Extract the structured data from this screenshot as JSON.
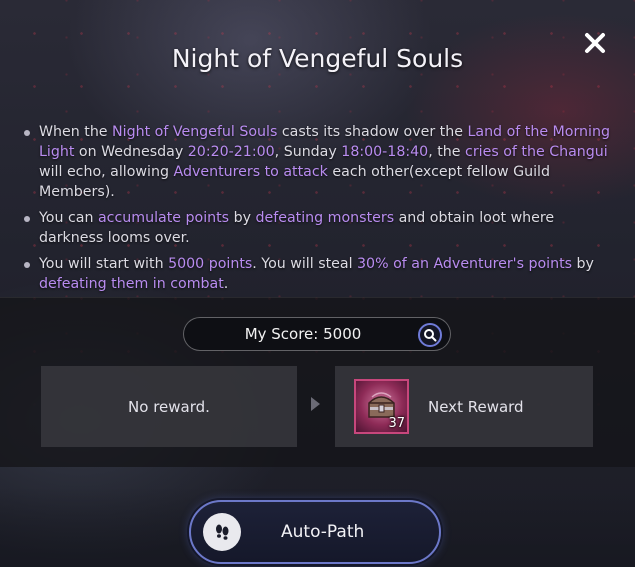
{
  "dialog": {
    "title": "Night of Vengeful Souls",
    "close_icon": "close-icon"
  },
  "description": {
    "bullets": [
      {
        "segments": [
          {
            "text": "When the ",
            "hl": false
          },
          {
            "text": "Night of Vengeful Souls",
            "hl": true
          },
          {
            "text": " casts its shadow over the ",
            "hl": false
          },
          {
            "text": "Land of the Morning Light",
            "hl": true
          },
          {
            "text": " on Wednesday ",
            "hl": false
          },
          {
            "text": "20:20-21:00",
            "hl": true
          },
          {
            "text": ", Sunday ",
            "hl": false
          },
          {
            "text": "18:00-18:40",
            "hl": true
          },
          {
            "text": ", the ",
            "hl": false
          },
          {
            "text": "cries of the Changui",
            "hl": true
          },
          {
            "text": " will echo, allowing ",
            "hl": false
          },
          {
            "text": "Adventurers to attack",
            "hl": true
          },
          {
            "text": " each other(except fellow Guild Members).",
            "hl": false
          }
        ]
      },
      {
        "segments": [
          {
            "text": "You can ",
            "hl": false
          },
          {
            "text": "accumulate points",
            "hl": true
          },
          {
            "text": " by ",
            "hl": false
          },
          {
            "text": "defeating monsters",
            "hl": true
          },
          {
            "text": " and obtain loot where darkness looms over.",
            "hl": false
          }
        ]
      },
      {
        "segments": [
          {
            "text": "You will start with ",
            "hl": false
          },
          {
            "text": "5000 points",
            "hl": true
          },
          {
            "text": ". You will steal ",
            "hl": false
          },
          {
            "text": "30% of an Adventurer's points",
            "hl": true
          },
          {
            "text": " by ",
            "hl": false
          },
          {
            "text": "defeating them in combat",
            "hl": true
          },
          {
            "text": ".",
            "hl": false
          }
        ]
      }
    ]
  },
  "score": {
    "label": "My Score:",
    "value": "5000",
    "search_icon": "magnifier-icon"
  },
  "rewards": {
    "current_label": "No reward.",
    "next_label": "Next Reward",
    "next_item_count": "37",
    "next_item_icon": "treasure-chest-icon"
  },
  "auto_path": {
    "label": "Auto-Path",
    "icon": "footprints-icon"
  },
  "colors": {
    "highlight": "#b98cf0",
    "button_border": "#6c78c9",
    "item_border": "#c7477c"
  }
}
